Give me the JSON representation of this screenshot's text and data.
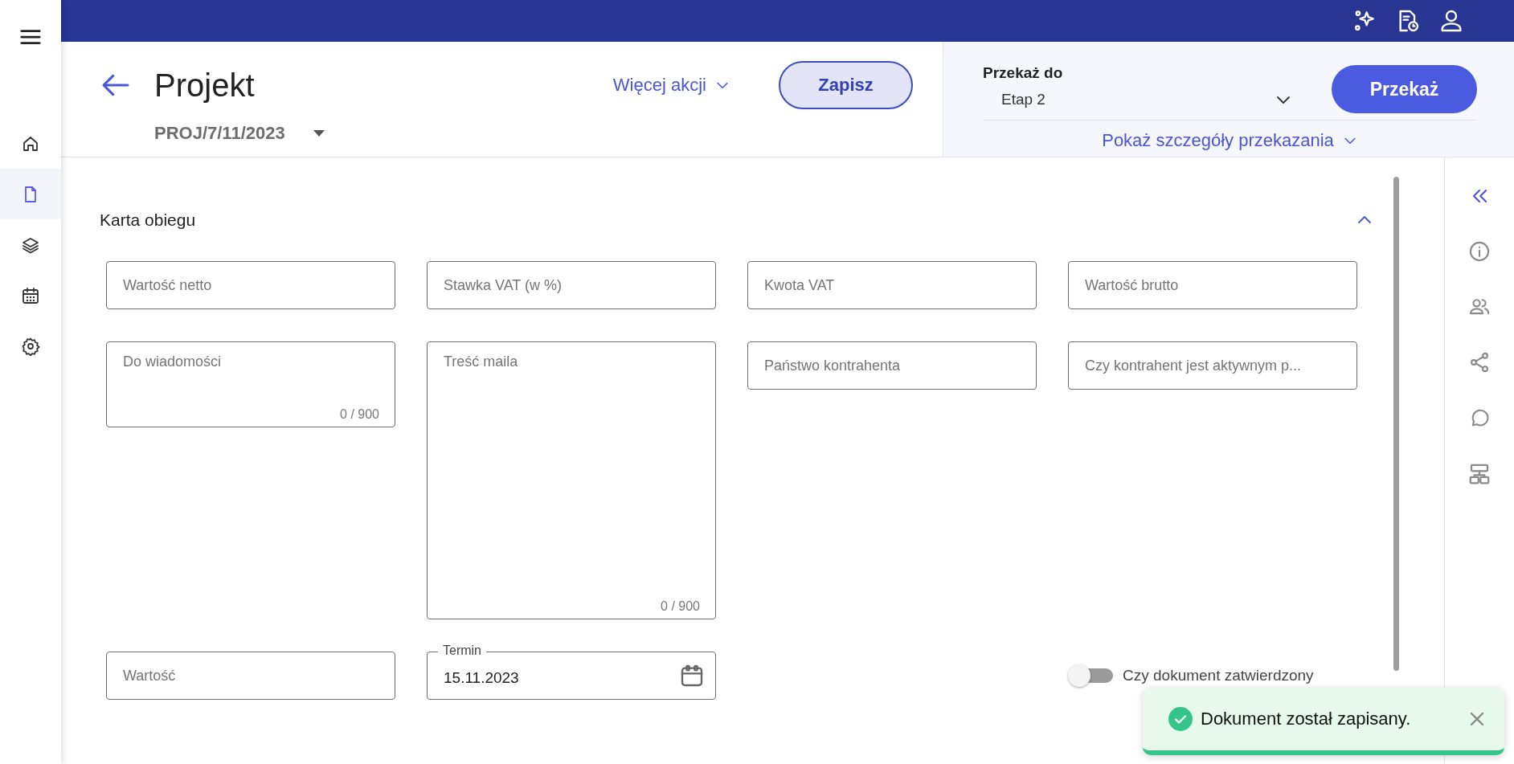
{
  "nav": {
    "items": [
      {
        "kind": "home",
        "selected": false
      },
      {
        "kind": "document",
        "selected": true
      },
      {
        "kind": "layers",
        "selected": false
      },
      {
        "kind": "calendar",
        "selected": false
      },
      {
        "kind": "settings",
        "selected": false
      }
    ]
  },
  "header": {
    "title": "Projekt",
    "document_number": "PROJ/7/11/2023",
    "more_actions": "Więcej akcji",
    "save_button": "Zapisz"
  },
  "transfer": {
    "label": "Przekaż do",
    "value": "Etap 2",
    "button": "Przekaż",
    "details_link": "Pokaż szczegóły przekazania"
  },
  "section": {
    "title": "Karta obiegu",
    "expanded": true,
    "fields": [
      {
        "kind": "text",
        "placeholder": "Wartość netto"
      },
      {
        "kind": "text",
        "placeholder": "Stawka VAT (w %)"
      },
      {
        "kind": "text",
        "placeholder": "Kwota VAT"
      },
      {
        "kind": "text",
        "placeholder": "Wartość brutto"
      },
      {
        "kind": "textarea",
        "placeholder": "Do wiadomości",
        "counter": "0 / 900"
      },
      {
        "kind": "tall_textarea",
        "placeholder": "Treść maila",
        "counter": "0 / 900"
      },
      {
        "kind": "text",
        "placeholder": "Państwo kontrahenta"
      },
      {
        "kind": "text",
        "placeholder": "Czy kontrahent jest aktywnym p..."
      },
      {
        "kind": "text",
        "placeholder": "Wartość"
      },
      {
        "kind": "date",
        "label": "Termin",
        "value": "15.11.2023"
      },
      {
        "kind": "toggle",
        "label": "Czy dokument zatwierdzony",
        "on": false
      }
    ]
  },
  "toast": {
    "message": "Dokument został zapisany."
  }
}
